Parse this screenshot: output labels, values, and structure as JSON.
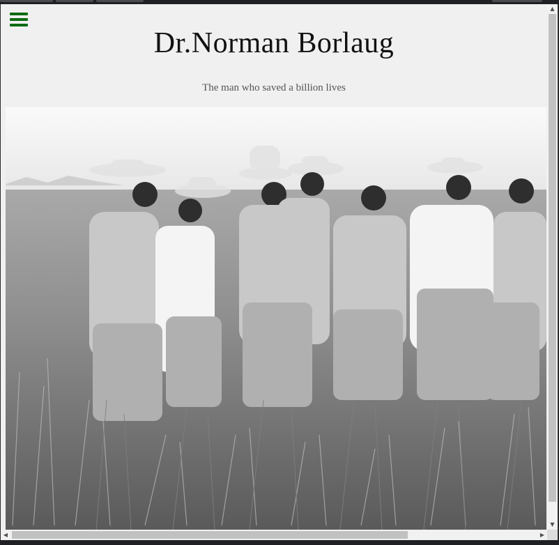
{
  "header": {
    "title": "Dr.Norman Borlaug",
    "subtitle": "The man who saved a billion lives"
  },
  "menu": {
    "icon": "hamburger-menu-icon"
  },
  "hero_image": {
    "description_icon": "photo"
  },
  "colors": {
    "menu_icon": "#0d6b12",
    "page_background": "#f0f0f0",
    "title_text": "#111111",
    "subtitle_text": "#555555"
  },
  "scrollbars": {
    "up_arrow": "▲",
    "down_arrow": "▼",
    "left_arrow": "◀",
    "right_arrow": "▶"
  }
}
